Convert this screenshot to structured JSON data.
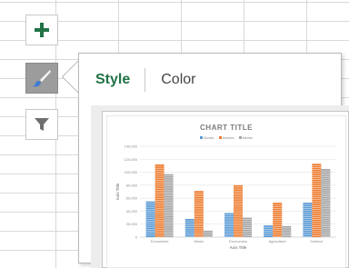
{
  "sidebar": {
    "add_icon": "plus-icon",
    "style_icon": "paintbrush-icon",
    "filter_icon": "funnel-icon"
  },
  "tabs": [
    {
      "label": "Style"
    },
    {
      "label": "Color"
    }
  ],
  "colors": {
    "accent": "#217346",
    "series": [
      "#5b9bd5",
      "#ed7d31",
      "#a5a5a5"
    ]
  },
  "chart_data": {
    "type": "bar",
    "title": "CHART TITLE",
    "xlabel": "Axis Title",
    "ylabel": "Axis Title",
    "categories": [
      "Economics",
      "Music",
      "Economics",
      "Agriculture",
      "Science"
    ],
    "series": [
      {
        "name": "Books",
        "values": [
          55000,
          28000,
          37000,
          18000,
          53000
        ]
      },
      {
        "name": "Articles",
        "values": [
          112000,
          71000,
          80000,
          53000,
          113000
        ]
      },
      {
        "name": "Media",
        "values": [
          97000,
          10000,
          30000,
          17000,
          105000
        ]
      }
    ],
    "yticks": [
      "0",
      "20,000",
      "40,000",
      "60,000",
      "80,000",
      "100,000",
      "120,000",
      "140,000"
    ],
    "ylim": [
      0,
      140000
    ],
    "grid": true,
    "legend": "top"
  }
}
